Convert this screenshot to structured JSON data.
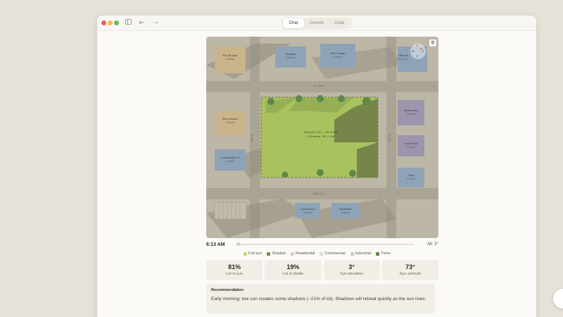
{
  "window": {
    "tabs": [
      "Chat",
      "Cowork",
      "Code"
    ],
    "active_tab": "Chat",
    "icons": [
      "sidebar-toggle-icon",
      "back-arrow-icon",
      "forward-arrow-icon"
    ]
  },
  "map": {
    "buildings": [
      {
        "name": "Elm St Apts",
        "floors": "4 floors",
        "type": "residential"
      },
      {
        "name": "Bodega",
        "floors": "2 floors",
        "type": "commercial"
      },
      {
        "name": "Mt St Tower",
        "floors": "8 floors",
        "type": "commercial"
      },
      {
        "name": "Office B",
        "floors": "6 floors",
        "type": "commercial"
      },
      {
        "name": "Row Houses",
        "floors": "3 floors",
        "type": "residential"
      },
      {
        "name": "Community Ctr",
        "floors": "2 floors",
        "type": "commercial"
      },
      {
        "name": "Warehouse",
        "floors": "2 floors",
        "type": "industrial"
      },
      {
        "name": "Auto Shop",
        "floors": "1 floors",
        "type": "industrial"
      },
      {
        "name": "Clinic",
        "floors": "4 floors",
        "type": "commercial"
      },
      {
        "name": "Laundromat",
        "floors": "3 floors",
        "type": "commercial"
      },
      {
        "name": "Hardware",
        "floors": "2 floors",
        "type": "commercial"
      }
    ],
    "streets": [
      "4th Street",
      "Maple Ave",
      "Elm St",
      "Oak St"
    ],
    "lot_title": "VACANT LOT — 4th & Elm",
    "lot_sub": "0.19 acres · 80' × 140'",
    "compass": {
      "n": "N",
      "e": "E",
      "s": "S",
      "w": "W"
    },
    "copy_icon": "copy-icon"
  },
  "time_control": {
    "time": "6:13 AM",
    "altitude": "Alt: 3°"
  },
  "legend": [
    {
      "label": "Full sun",
      "color": "#c9d67a"
    },
    {
      "label": "Shadow",
      "color": "#7d8a55"
    },
    {
      "label": "Residential",
      "color": "#d8d2c6"
    },
    {
      "label": "Commercial",
      "color": "#d6dbe2"
    },
    {
      "label": "Industrial",
      "color": "#cfcbd3"
    },
    {
      "label": "Trees",
      "color": "#5d8a4a"
    }
  ],
  "stats": [
    {
      "value": "81%",
      "label": "Lot in sun"
    },
    {
      "value": "19%",
      "label": "Lot in shade"
    },
    {
      "value": "3°",
      "label": "Sun elevation"
    },
    {
      "value": "73°",
      "label": "Sun azimuth"
    }
  ],
  "recommendation": {
    "title": "Recommendation",
    "body": "Early morning: low sun creates some shadows (~21% of lot). Shadows will retreat quickly as the sun rises."
  },
  "colors": {
    "lot_fill": "#a9c25e",
    "tree": "#5d8a4a",
    "road": "#a9a494",
    "building_blue": "#8fa3b8",
    "building_tan": "#c9b48c",
    "building_purple": "#9c95ad"
  }
}
